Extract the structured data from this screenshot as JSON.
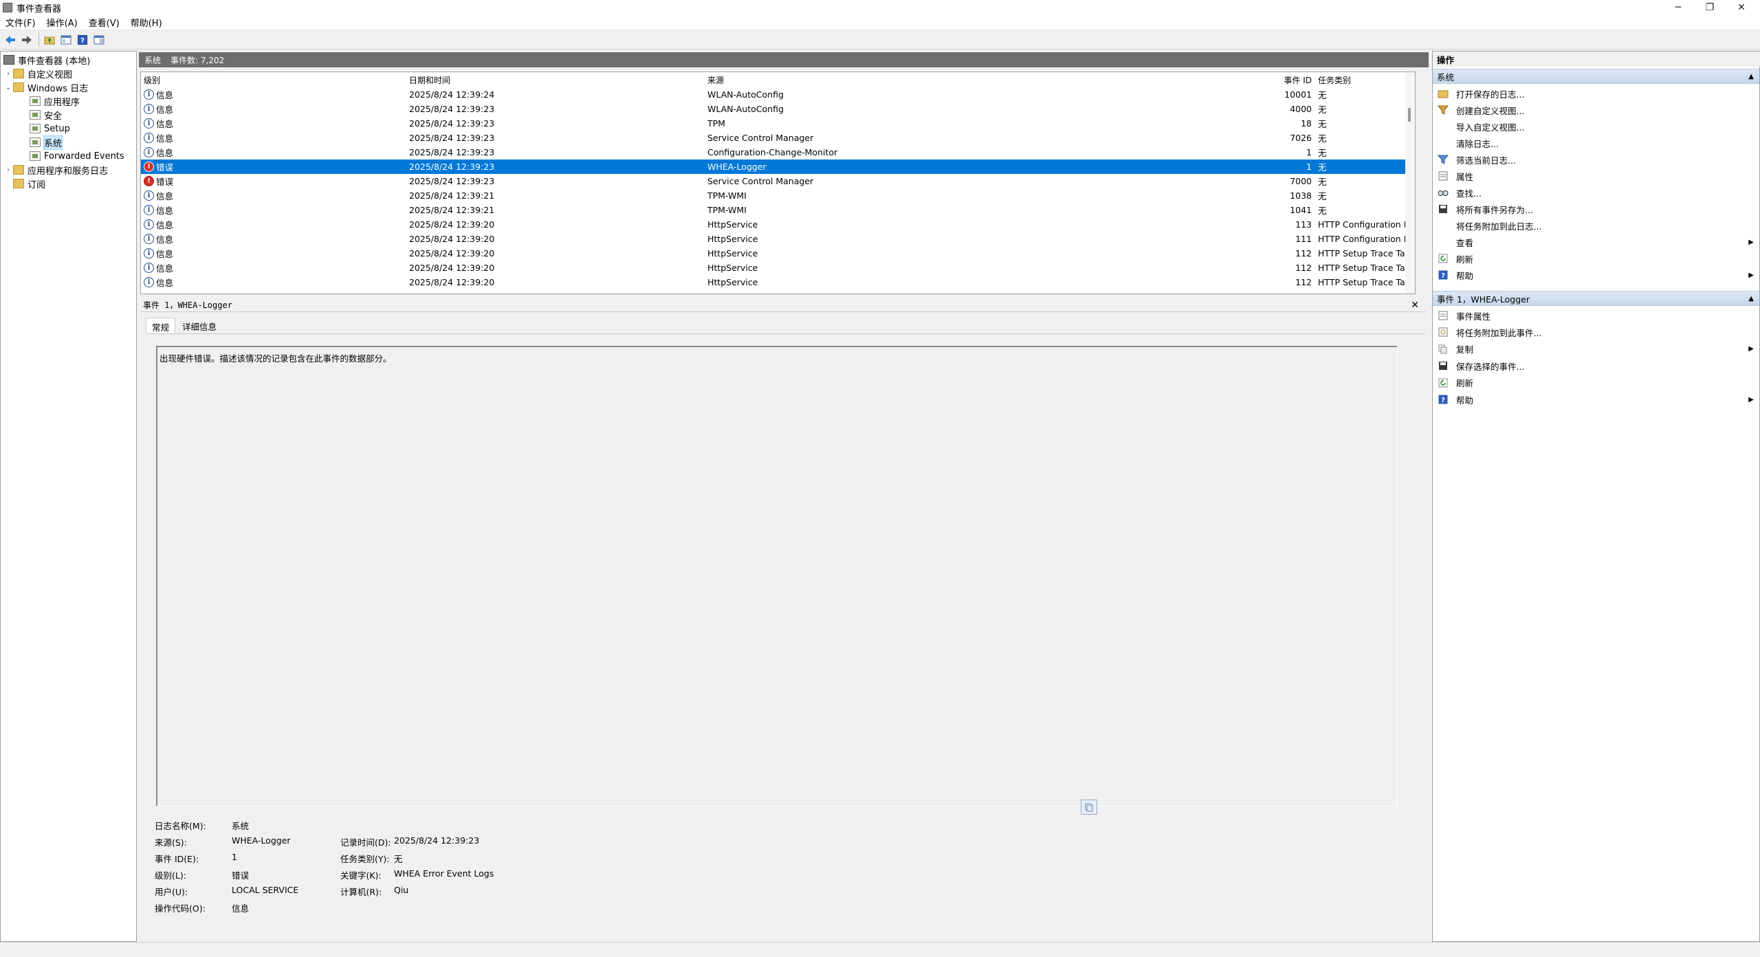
{
  "window": {
    "title": "事件查看器"
  },
  "menu": [
    "文件(F)",
    "操作(A)",
    "查看(V)",
    "帮助(H)"
  ],
  "tree": {
    "root": "事件查看器 (本地)",
    "custom_views": "自定义视图",
    "windows_logs": "Windows 日志",
    "application": "应用程序",
    "security": "安全",
    "setup": "Setup",
    "system": "系统",
    "forwarded": "Forwarded Events",
    "app_service_logs": "应用程序和服务日志",
    "subscriptions": "订阅"
  },
  "list_header": {
    "name": "系统",
    "count": "事件数: 7,202"
  },
  "columns": {
    "level": "级别",
    "date": "日期和时间",
    "source": "来源",
    "event_id": "事件 ID",
    "task": "任务类别"
  },
  "events": [
    {
      "level": "信息",
      "type": "info",
      "date": "2025/8/24 12:39:24",
      "source": "WLAN-AutoConfig",
      "id": "10001",
      "task": "无"
    },
    {
      "level": "信息",
      "type": "info",
      "date": "2025/8/24 12:39:23",
      "source": "WLAN-AutoConfig",
      "id": "4000",
      "task": "无"
    },
    {
      "level": "信息",
      "type": "info",
      "date": "2025/8/24 12:39:23",
      "source": "TPM",
      "id": "18",
      "task": "无"
    },
    {
      "level": "信息",
      "type": "info",
      "date": "2025/8/24 12:39:23",
      "source": "Service Control Manager",
      "id": "7026",
      "task": "无"
    },
    {
      "level": "信息",
      "type": "info",
      "date": "2025/8/24 12:39:23",
      "source": "Configuration-Change-Monitor",
      "id": "1",
      "task": "无"
    },
    {
      "level": "错误",
      "type": "error",
      "date": "2025/8/24 12:39:23",
      "source": "WHEA-Logger",
      "id": "1",
      "task": "无",
      "selected": true
    },
    {
      "level": "错误",
      "type": "error",
      "date": "2025/8/24 12:39:23",
      "source": "Service Control Manager",
      "id": "7000",
      "task": "无"
    },
    {
      "level": "信息",
      "type": "info",
      "date": "2025/8/24 12:39:21",
      "source": "TPM-WMI",
      "id": "1038",
      "task": "无"
    },
    {
      "level": "信息",
      "type": "info",
      "date": "2025/8/24 12:39:21",
      "source": "TPM-WMI",
      "id": "1041",
      "task": "无"
    },
    {
      "level": "信息",
      "type": "info",
      "date": "2025/8/24 12:39:20",
      "source": "HttpService",
      "id": "113",
      "task": "HTTP Configuration Property Trace Task"
    },
    {
      "level": "信息",
      "type": "info",
      "date": "2025/8/24 12:39:20",
      "source": "HttpService",
      "id": "111",
      "task": "HTTP Configuration Property Trace Task"
    },
    {
      "level": "信息",
      "type": "info",
      "date": "2025/8/24 12:39:20",
      "source": "HttpService",
      "id": "112",
      "task": "HTTP Setup Trace Task"
    },
    {
      "level": "信息",
      "type": "info",
      "date": "2025/8/24 12:39:20",
      "source": "HttpService",
      "id": "112",
      "task": "HTTP Setup Trace Task"
    },
    {
      "level": "信息",
      "type": "info",
      "date": "2025/8/24 12:39:20",
      "source": "HttpService",
      "id": "112",
      "task": "HTTP Setup Trace Task"
    }
  ],
  "detail": {
    "header": "事件 1，WHEA-Logger",
    "tabs": [
      "常规",
      "详细信息"
    ],
    "message": "出现硬件错误。描述该情况的记录包含在此事件的数据部分。",
    "labels": {
      "log_name": "日志名称(M):",
      "source": "来源(S):",
      "event_id": "事件 ID(E):",
      "level": "级别(L):",
      "user": "用户(U):",
      "opcode": "操作代码(O):",
      "logged": "记录时间(D):",
      "task": "任务类别(Y):",
      "keywords": "关键字(K):",
      "computer": "计算机(R):"
    },
    "values": {
      "log_name": "系统",
      "source": "WHEA-Logger",
      "event_id": "1",
      "level": "错误",
      "user": "LOCAL SERVICE",
      "opcode": "信息",
      "logged": "2025/8/24 12:39:23",
      "task": "无",
      "keywords": "WHEA Error Event Logs",
      "computer": "Qiu"
    }
  },
  "actions": {
    "title": "操作",
    "section1": "系统",
    "items1": [
      {
        "label": "打开保存的日志...",
        "icon": "open-folder-icon"
      },
      {
        "label": "创建自定义视图...",
        "icon": "filter-create-icon"
      },
      {
        "label": "导入自定义视图...",
        "icon": ""
      },
      {
        "label": "清除日志...",
        "icon": ""
      },
      {
        "label": "筛选当前日志...",
        "icon": "filter-icon"
      },
      {
        "label": "属性",
        "icon": "properties-icon"
      },
      {
        "label": "查找...",
        "icon": "find-icon"
      },
      {
        "label": "将所有事件另存为...",
        "icon": "save-icon"
      },
      {
        "label": "将任务附加到此日志...",
        "icon": ""
      },
      {
        "label": "查看",
        "icon": "",
        "submenu": true
      },
      {
        "label": "刷新",
        "icon": "refresh-icon"
      },
      {
        "label": "帮助",
        "icon": "help-icon",
        "submenu": true
      }
    ],
    "section2": "事件 1，WHEA-Logger",
    "items2": [
      {
        "label": "事件属性",
        "icon": "event-properties-icon"
      },
      {
        "label": "将任务附加到此事件...",
        "icon": "attach-task-icon"
      },
      {
        "label": "复制",
        "icon": "copy-icon",
        "submenu": true
      },
      {
        "label": "保存选择的事件...",
        "icon": "save-icon"
      },
      {
        "label": "刷新",
        "icon": "refresh-icon"
      },
      {
        "label": "帮助",
        "icon": "help-icon",
        "submenu": true
      }
    ]
  },
  "colors": {
    "selection": "#0078d7",
    "error": "#d32f2f",
    "info": "#2a4d8a"
  }
}
